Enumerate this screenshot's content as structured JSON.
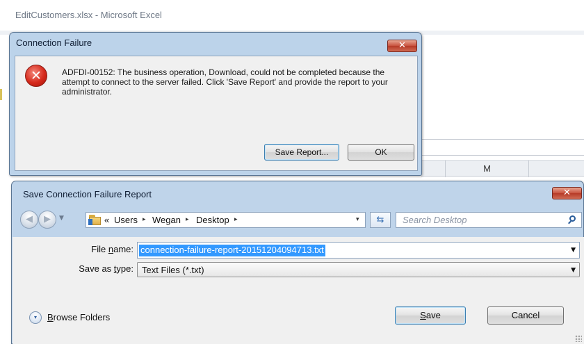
{
  "excel": {
    "window_title": "EditCustomers.xlsx  -  Microsoft Excel",
    "column_header": "M"
  },
  "connection_dialog": {
    "title": "Connection Failure",
    "close_glyph": "✕",
    "icon": "error-icon",
    "icon_glyph": "✕",
    "message": "ADFDI-00152: The business operation, Download, could not be completed because the attempt to connect to the server failed. Click 'Save Report' and provide the report to your administrator.",
    "buttons": {
      "save_report": "Save Report...",
      "ok": "OK"
    }
  },
  "save_dialog": {
    "title": "Save Connection Failure Report",
    "close_glyph": "✕",
    "address": {
      "overflow_glyph": "«",
      "crumbs": [
        "Users",
        "Wegan",
        "Desktop"
      ],
      "separator_glyph": "▸",
      "dropdown_glyph": "▾"
    },
    "refresh_glyph": "⇆",
    "search": {
      "placeholder": "Search Desktop"
    },
    "file_name": {
      "label_pre": "File ",
      "label_ul": "n",
      "label_post": "ame:",
      "value": "connection-failure-report-20151204094713.txt"
    },
    "save_as_type": {
      "label_pre": "Save as ",
      "label_ul": "t",
      "label_post": "ype:",
      "value": "Text Files (*.txt)"
    },
    "browse_folders": {
      "label_ul": "B",
      "label_post": "rowse Folders",
      "glyph": "▾"
    },
    "buttons": {
      "save_ul": "S",
      "save_post": "ave",
      "cancel": "Cancel"
    }
  },
  "colors": {
    "dialog_frame": "#bfd4ea",
    "close_button": "#c8523f",
    "selection": "#3399ff",
    "default_button_border": "#3c7fb1"
  }
}
